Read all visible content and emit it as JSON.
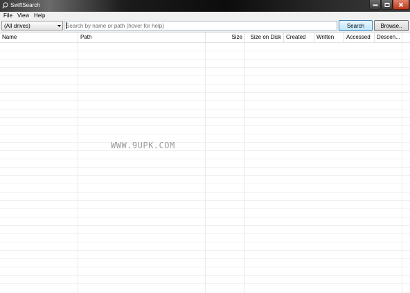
{
  "window": {
    "title": "SwiftSearch"
  },
  "menu": {
    "file": "File",
    "view": "View",
    "help": "Help"
  },
  "toolbar": {
    "drive_selected": "(All drives)",
    "search_placeholder": "Search by name or path (hover for help)",
    "search_label": "Search",
    "browse_label": "Browse.."
  },
  "columns": [
    "Name",
    "Path",
    "Size",
    "Size on Disk",
    "Created",
    "Written",
    "Accessed",
    "Descen..."
  ],
  "watermark": "WWW.9UPK.COM",
  "colors": {
    "title_bar": "#1c1c1c",
    "close_button": "#c0391c",
    "search_button_border": "#3c7fb1"
  }
}
